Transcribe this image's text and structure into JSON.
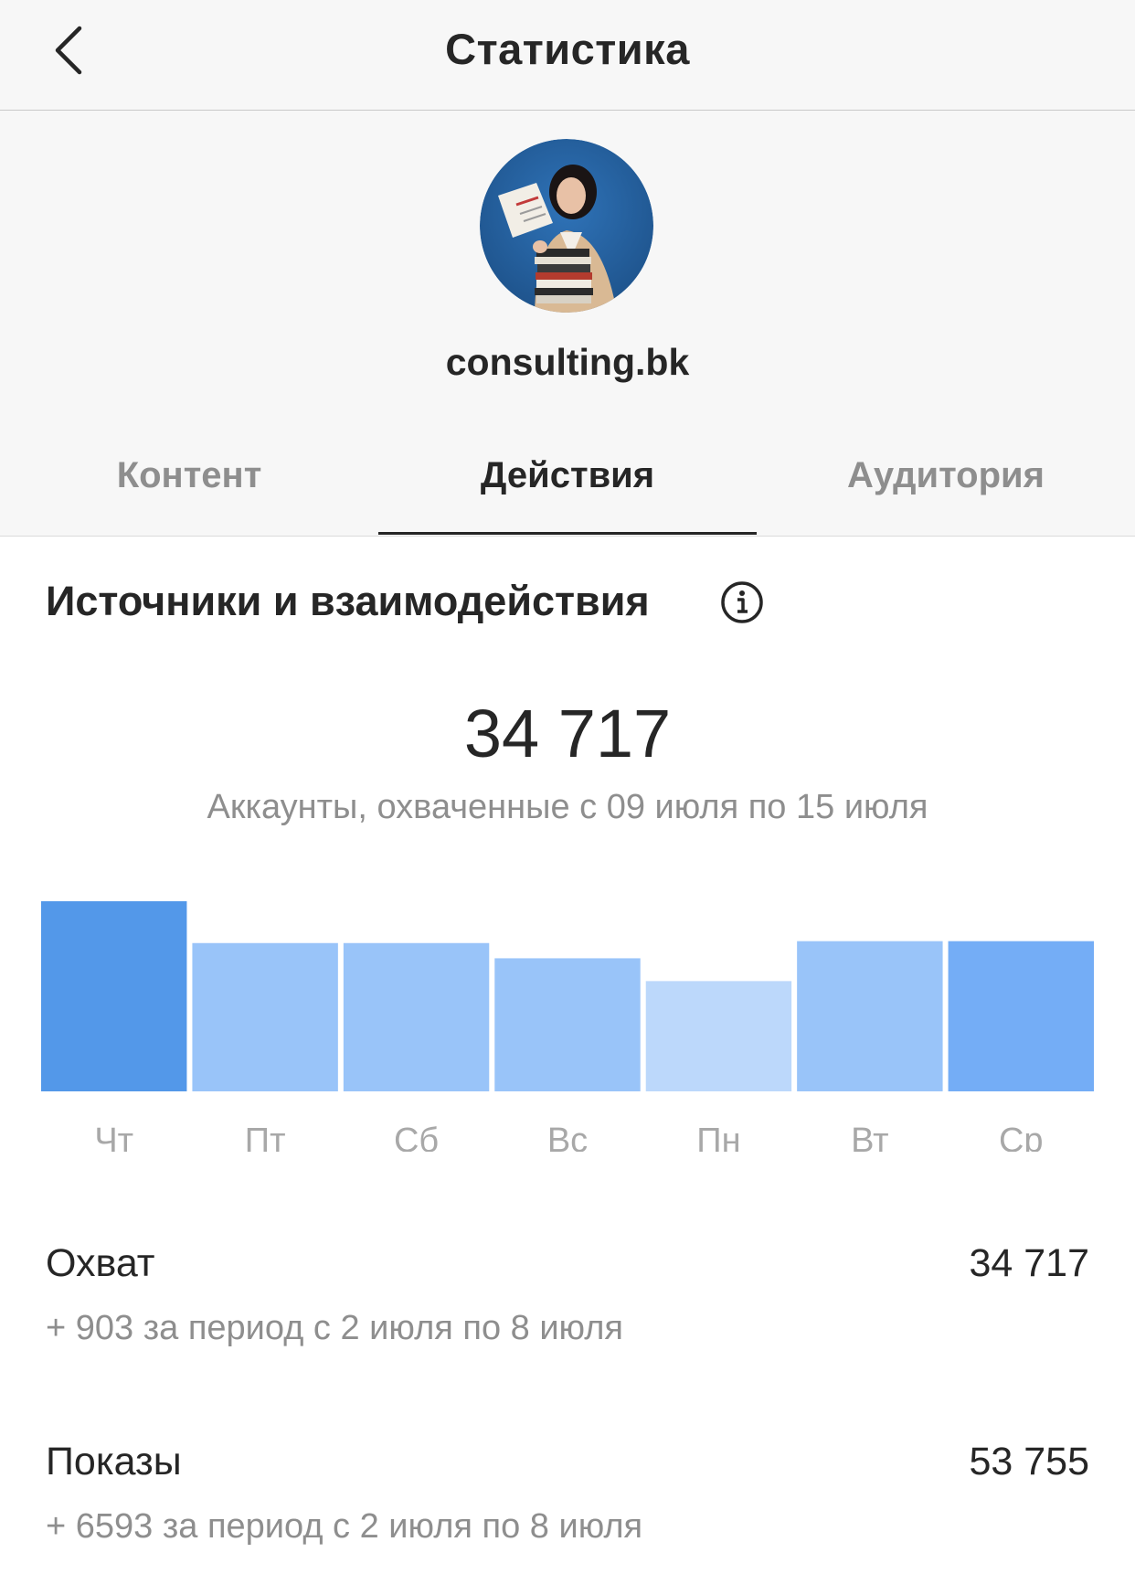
{
  "header": {
    "title": "Статистика"
  },
  "profile": {
    "username": "consulting.bk"
  },
  "tabs": [
    {
      "label": "Контент",
      "active": false
    },
    {
      "label": "Действия",
      "active": true
    },
    {
      "label": "Аудитория",
      "active": false
    }
  ],
  "section": {
    "title": "Источники и взаимодействия"
  },
  "reach": {
    "total": "34 717",
    "caption": "Аккаунты, охваченные с 09 июля по 15 июля"
  },
  "chart_data": {
    "type": "bar",
    "categories": [
      "Чт",
      "Пт",
      "Сб",
      "Вс",
      "Пн",
      "Вт",
      "Ср"
    ],
    "values": [
      100,
      78,
      78,
      70,
      58,
      79,
      79
    ],
    "colors": [
      "#5398e9",
      "#99c4f9",
      "#99c4f9",
      "#99c4f9",
      "#bcd8fb",
      "#99c4f9",
      "#74adf6"
    ],
    "ylim": [
      0,
      100
    ],
    "grid": false
  },
  "metrics": [
    {
      "label": "Охват",
      "value": "34 717",
      "sub": "+ 903 за период с 2 июля по 8 июля"
    },
    {
      "label": "Показы",
      "value": "53 755",
      "sub": "+ 6593 за период с 2 июля по 8 июля"
    }
  ]
}
